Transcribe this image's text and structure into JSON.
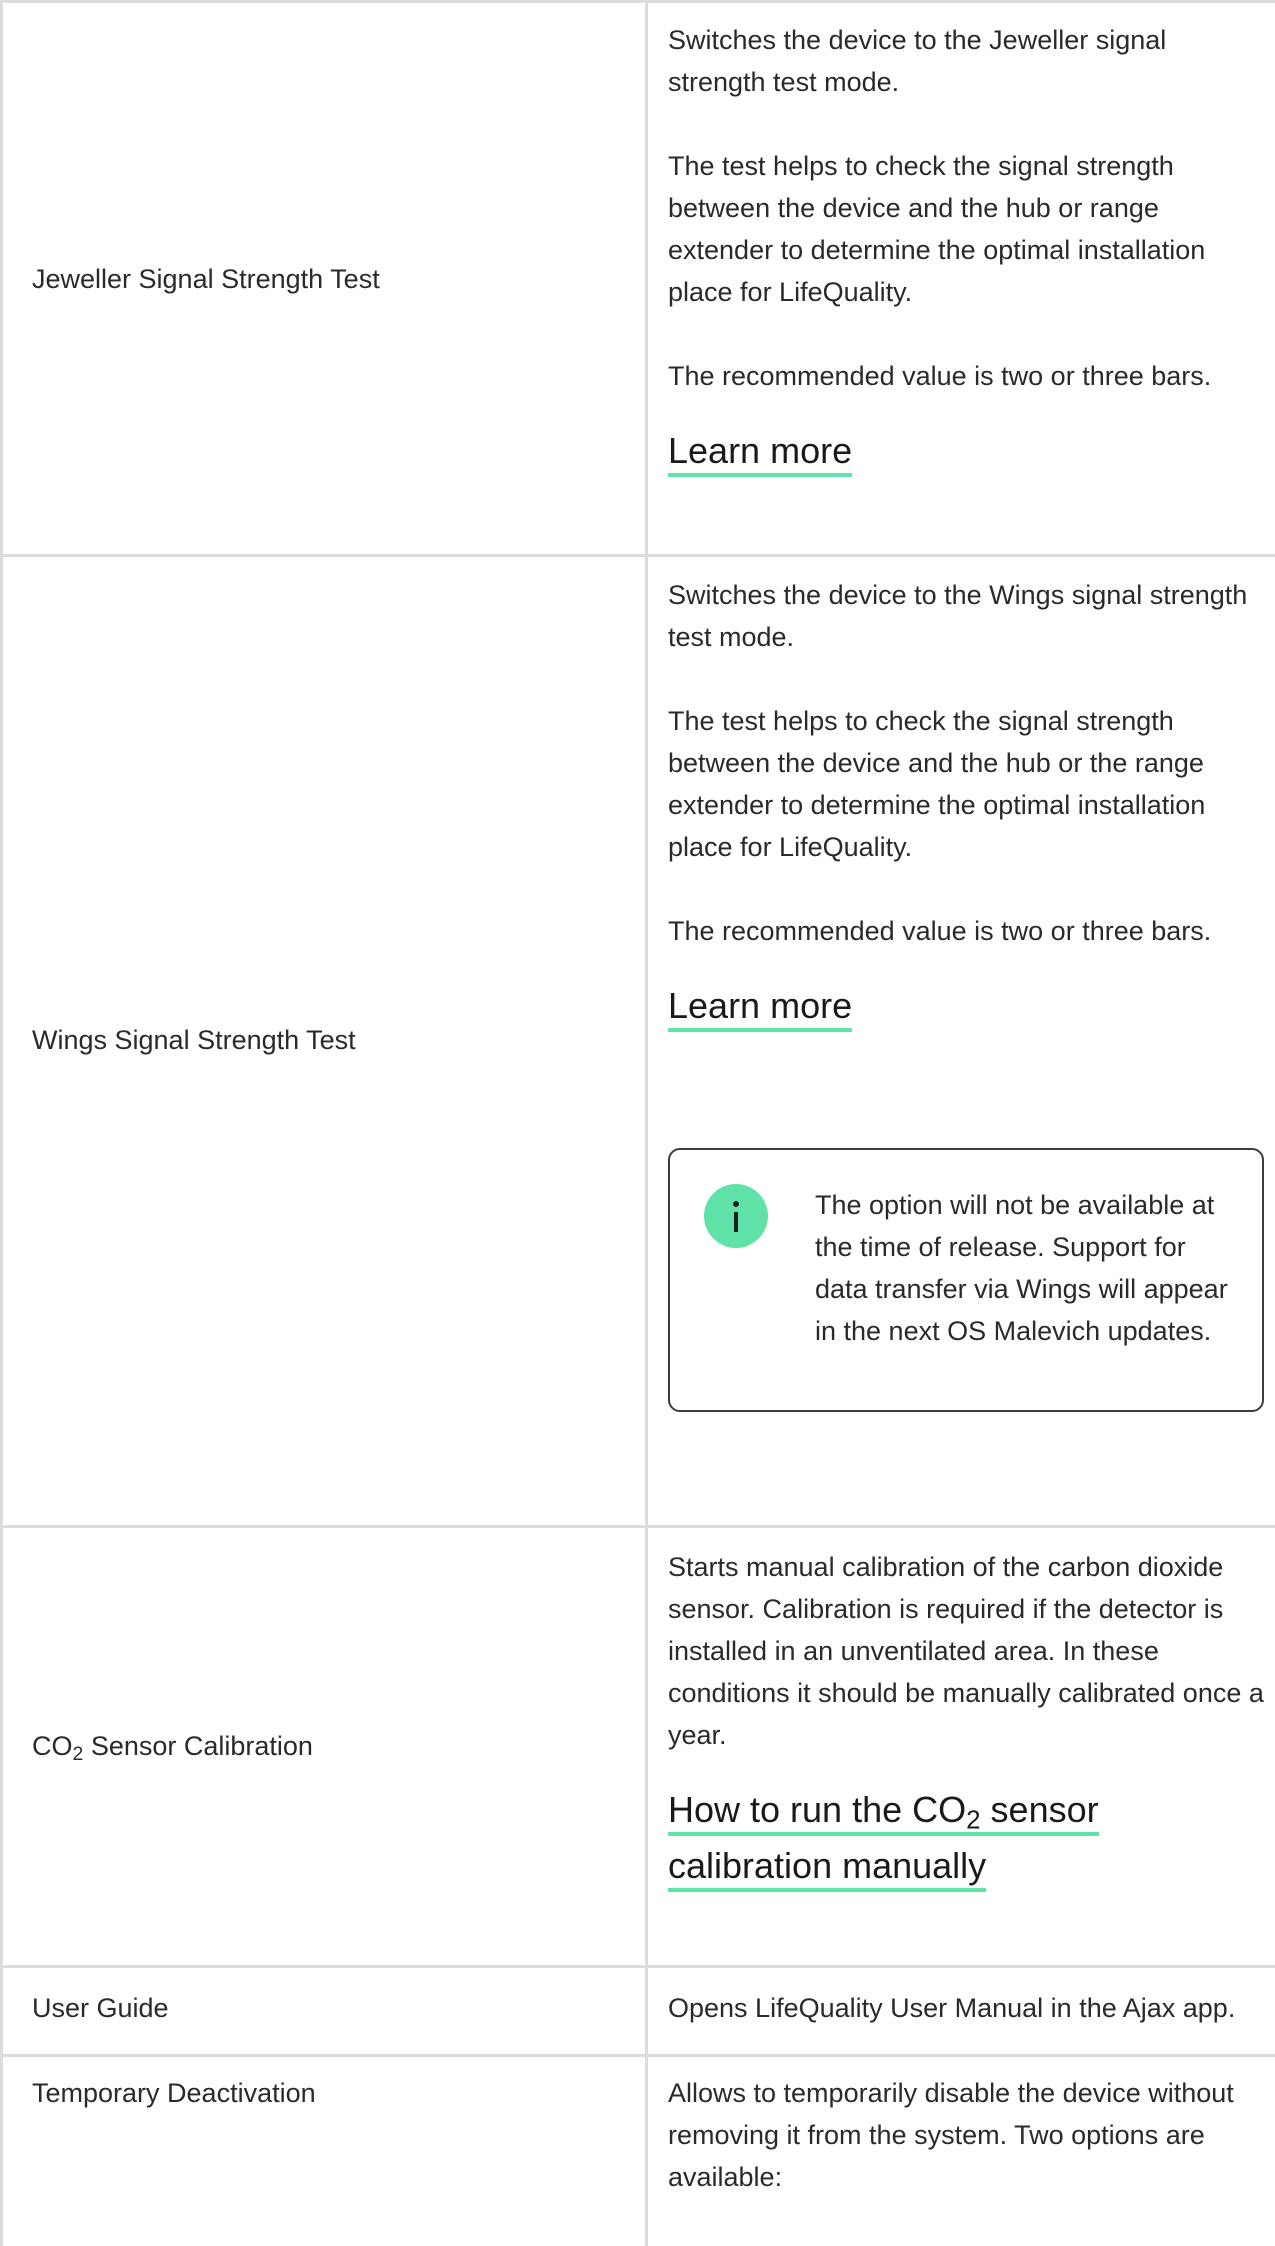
{
  "rows": [
    {
      "label": "Jeweller Signal Strength Test",
      "paragraphs": [
        "Switches the device to the Jeweller signal strength test mode.",
        "The test helps to check the signal strength between the device and the hub or range extender to determine the optimal installation place for LifeQuality.",
        "The recommended value is two or three bars."
      ],
      "link": "Learn more"
    },
    {
      "label": "Wings Signal Strength Test",
      "paragraphs": [
        "Switches the device to the Wings signal strength test mode.",
        "The test helps to check the signal strength between the device and the hub or the range extender to determine the optimal installation place for LifeQuality.",
        "The recommended value is two or three bars."
      ],
      "link": "Learn more",
      "note": {
        "icon": "info-icon",
        "text": "The option will not be available at the time of release. Support for data transfer via Wings will appear in the next OS Malevich updates."
      }
    },
    {
      "label_prefix": "CO",
      "label_sub": "2",
      "label_suffix": " Sensor Calibration",
      "paragraph": "Starts manual calibration of the carbon dioxide sensor. Calibration is required if the detector is installed in an unventilated area. In these conditions it should be manually calibrated once a year.",
      "link_prefix": "How to run the CO",
      "link_sub": "2",
      "link_line1_suffix": " sensor",
      "link_line2": "calibration manually"
    },
    {
      "label": "User Guide",
      "paragraph": "Opens LifeQuality User Manual in the Ajax app."
    },
    {
      "label": "Temporary Deactivation",
      "paragraph": "Allows to temporarily disable the device without removing it from the system. Two options are available:"
    }
  ],
  "colors": {
    "accent": "#5fe3a8",
    "border": "#dcdcdc"
  }
}
